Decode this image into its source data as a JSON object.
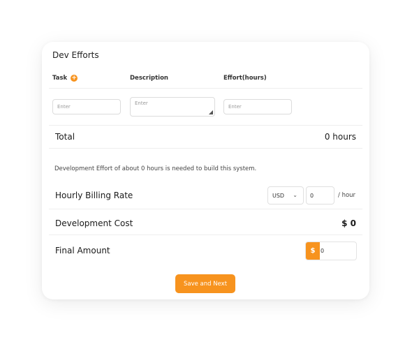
{
  "section": {
    "title": "Dev Efforts"
  },
  "columns": {
    "task": "Task",
    "description": "Description",
    "effort": "Effort(hours)"
  },
  "inputs": {
    "task_placeholder": "Enter",
    "description_placeholder": "Enter",
    "effort_placeholder": "Enter"
  },
  "total": {
    "label": "Total",
    "value": "0 hours"
  },
  "info_text": "Development Effort of about 0 hours is needed to build this system.",
  "billing": {
    "label": "Hourly Billing Rate",
    "currency": "USD",
    "rate": "0",
    "unit": "/ hour"
  },
  "dev_cost": {
    "label": "Development Cost",
    "value": "$ 0"
  },
  "final": {
    "label": "Final Amount",
    "currency_symbol": "$",
    "value": "0"
  },
  "actions": {
    "save_label": "Save and Next"
  },
  "colors": {
    "accent": "#f7931e"
  },
  "icons": {
    "add": "plus-circle-icon",
    "dropdown": "chevron-down-icon",
    "resize": "resize-grip-icon"
  }
}
